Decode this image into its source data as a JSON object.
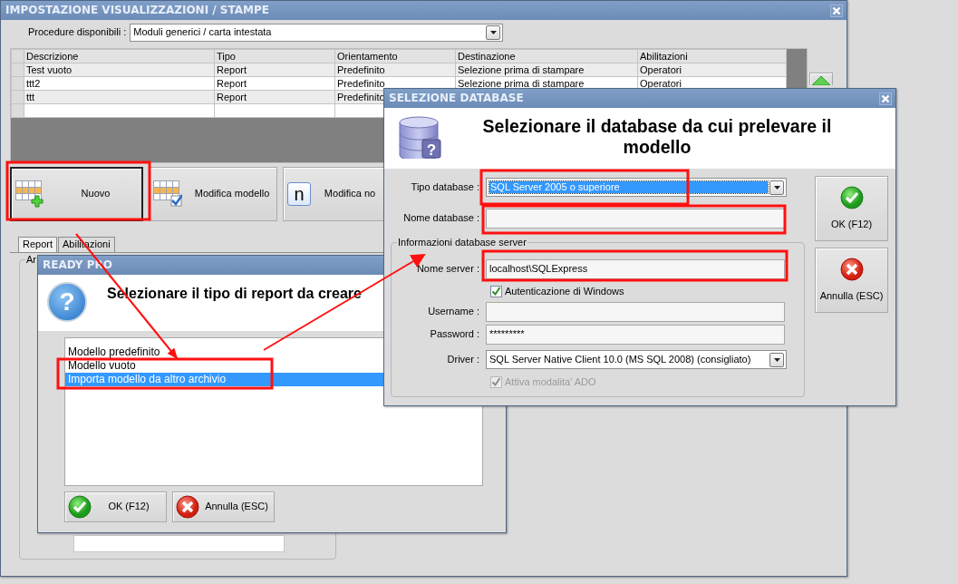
{
  "main_window": {
    "title": "IMPOSTAZIONE VISUALIZZAZIONI / STAMPE",
    "procedure_label": "Procedure disponibili :",
    "procedure_value": "Moduli generici / carta intestata",
    "table": {
      "columns": [
        "Descrizione",
        "Tipo",
        "Orientamento",
        "Destinazione",
        "Abilitazioni"
      ],
      "rows": [
        {
          "cells": [
            "Test vuoto",
            "Report",
            "Predefinito",
            "Selezione prima di stampare",
            "Operatori"
          ]
        },
        {
          "cells": [
            "ttt2",
            "Report",
            "Predefinito",
            "Selezione prima di stampare",
            "Operatori"
          ]
        },
        {
          "cells": [
            "ttt",
            "Report",
            "Predefinito"
          ]
        }
      ]
    },
    "buttons": [
      {
        "label": "Nuovo",
        "kind": "new"
      },
      {
        "label": "Modifica modello",
        "kind": "edit"
      },
      {
        "label": "Modifica no",
        "kind": "letter",
        "glyph": "n"
      }
    ],
    "tabs": [
      {
        "label": "Report",
        "selected": true
      },
      {
        "label": "Abilitazioni",
        "selected": false
      }
    ],
    "group_label": "Ar"
  },
  "report_dialog": {
    "title": "READY PRO",
    "glyph": "?",
    "heading": "Selezionare il tipo di report da creare",
    "options": [
      {
        "label": "Modello predefinito",
        "selected": false
      },
      {
        "label": "Modello vuoto",
        "selected": false
      },
      {
        "label": "Importa modello da altro archivio",
        "selected": true
      }
    ],
    "buttons": [
      {
        "label": "OK (F12)",
        "kind": "ok"
      },
      {
        "label": "Annulla (ESC)",
        "kind": "cancel"
      }
    ]
  },
  "database_dialog": {
    "title": "SELEZIONE DATABASE",
    "glyph": "?",
    "heading": "Selezionare il database da cui prelevare il modello",
    "fields": [
      {
        "kind": "select",
        "label": "Tipo database :",
        "value": "SQL Server 2005 o superiore",
        "selected": true
      },
      {
        "kind": "text",
        "label": "Nome database :"
      }
    ],
    "group_label": "Informazioni database server",
    "server_fields": [
      {
        "kind": "text",
        "label": "Nome server :",
        "value": "localhost\\SQLExpress"
      },
      {
        "kind": "checkbox",
        "label": "Autenticazione di Windows",
        "checked": true,
        "disabled": false
      },
      {
        "kind": "text",
        "label": "Username :"
      },
      {
        "kind": "text",
        "label": "Password :",
        "value": "*********"
      },
      {
        "kind": "select",
        "label": "Driver :",
        "value": "SQL Server Native Client 10.0 (MS SQL 2008) (consigliato)",
        "selected": false
      },
      {
        "kind": "checkbox",
        "label": "Attiva modalita' ADO",
        "checked": true,
        "disabled": true
      }
    ],
    "buttons": [
      {
        "label": "OK (F12)",
        "kind": "ok"
      },
      {
        "label": "Annulla (ESC)",
        "kind": "cancel"
      }
    ]
  }
}
